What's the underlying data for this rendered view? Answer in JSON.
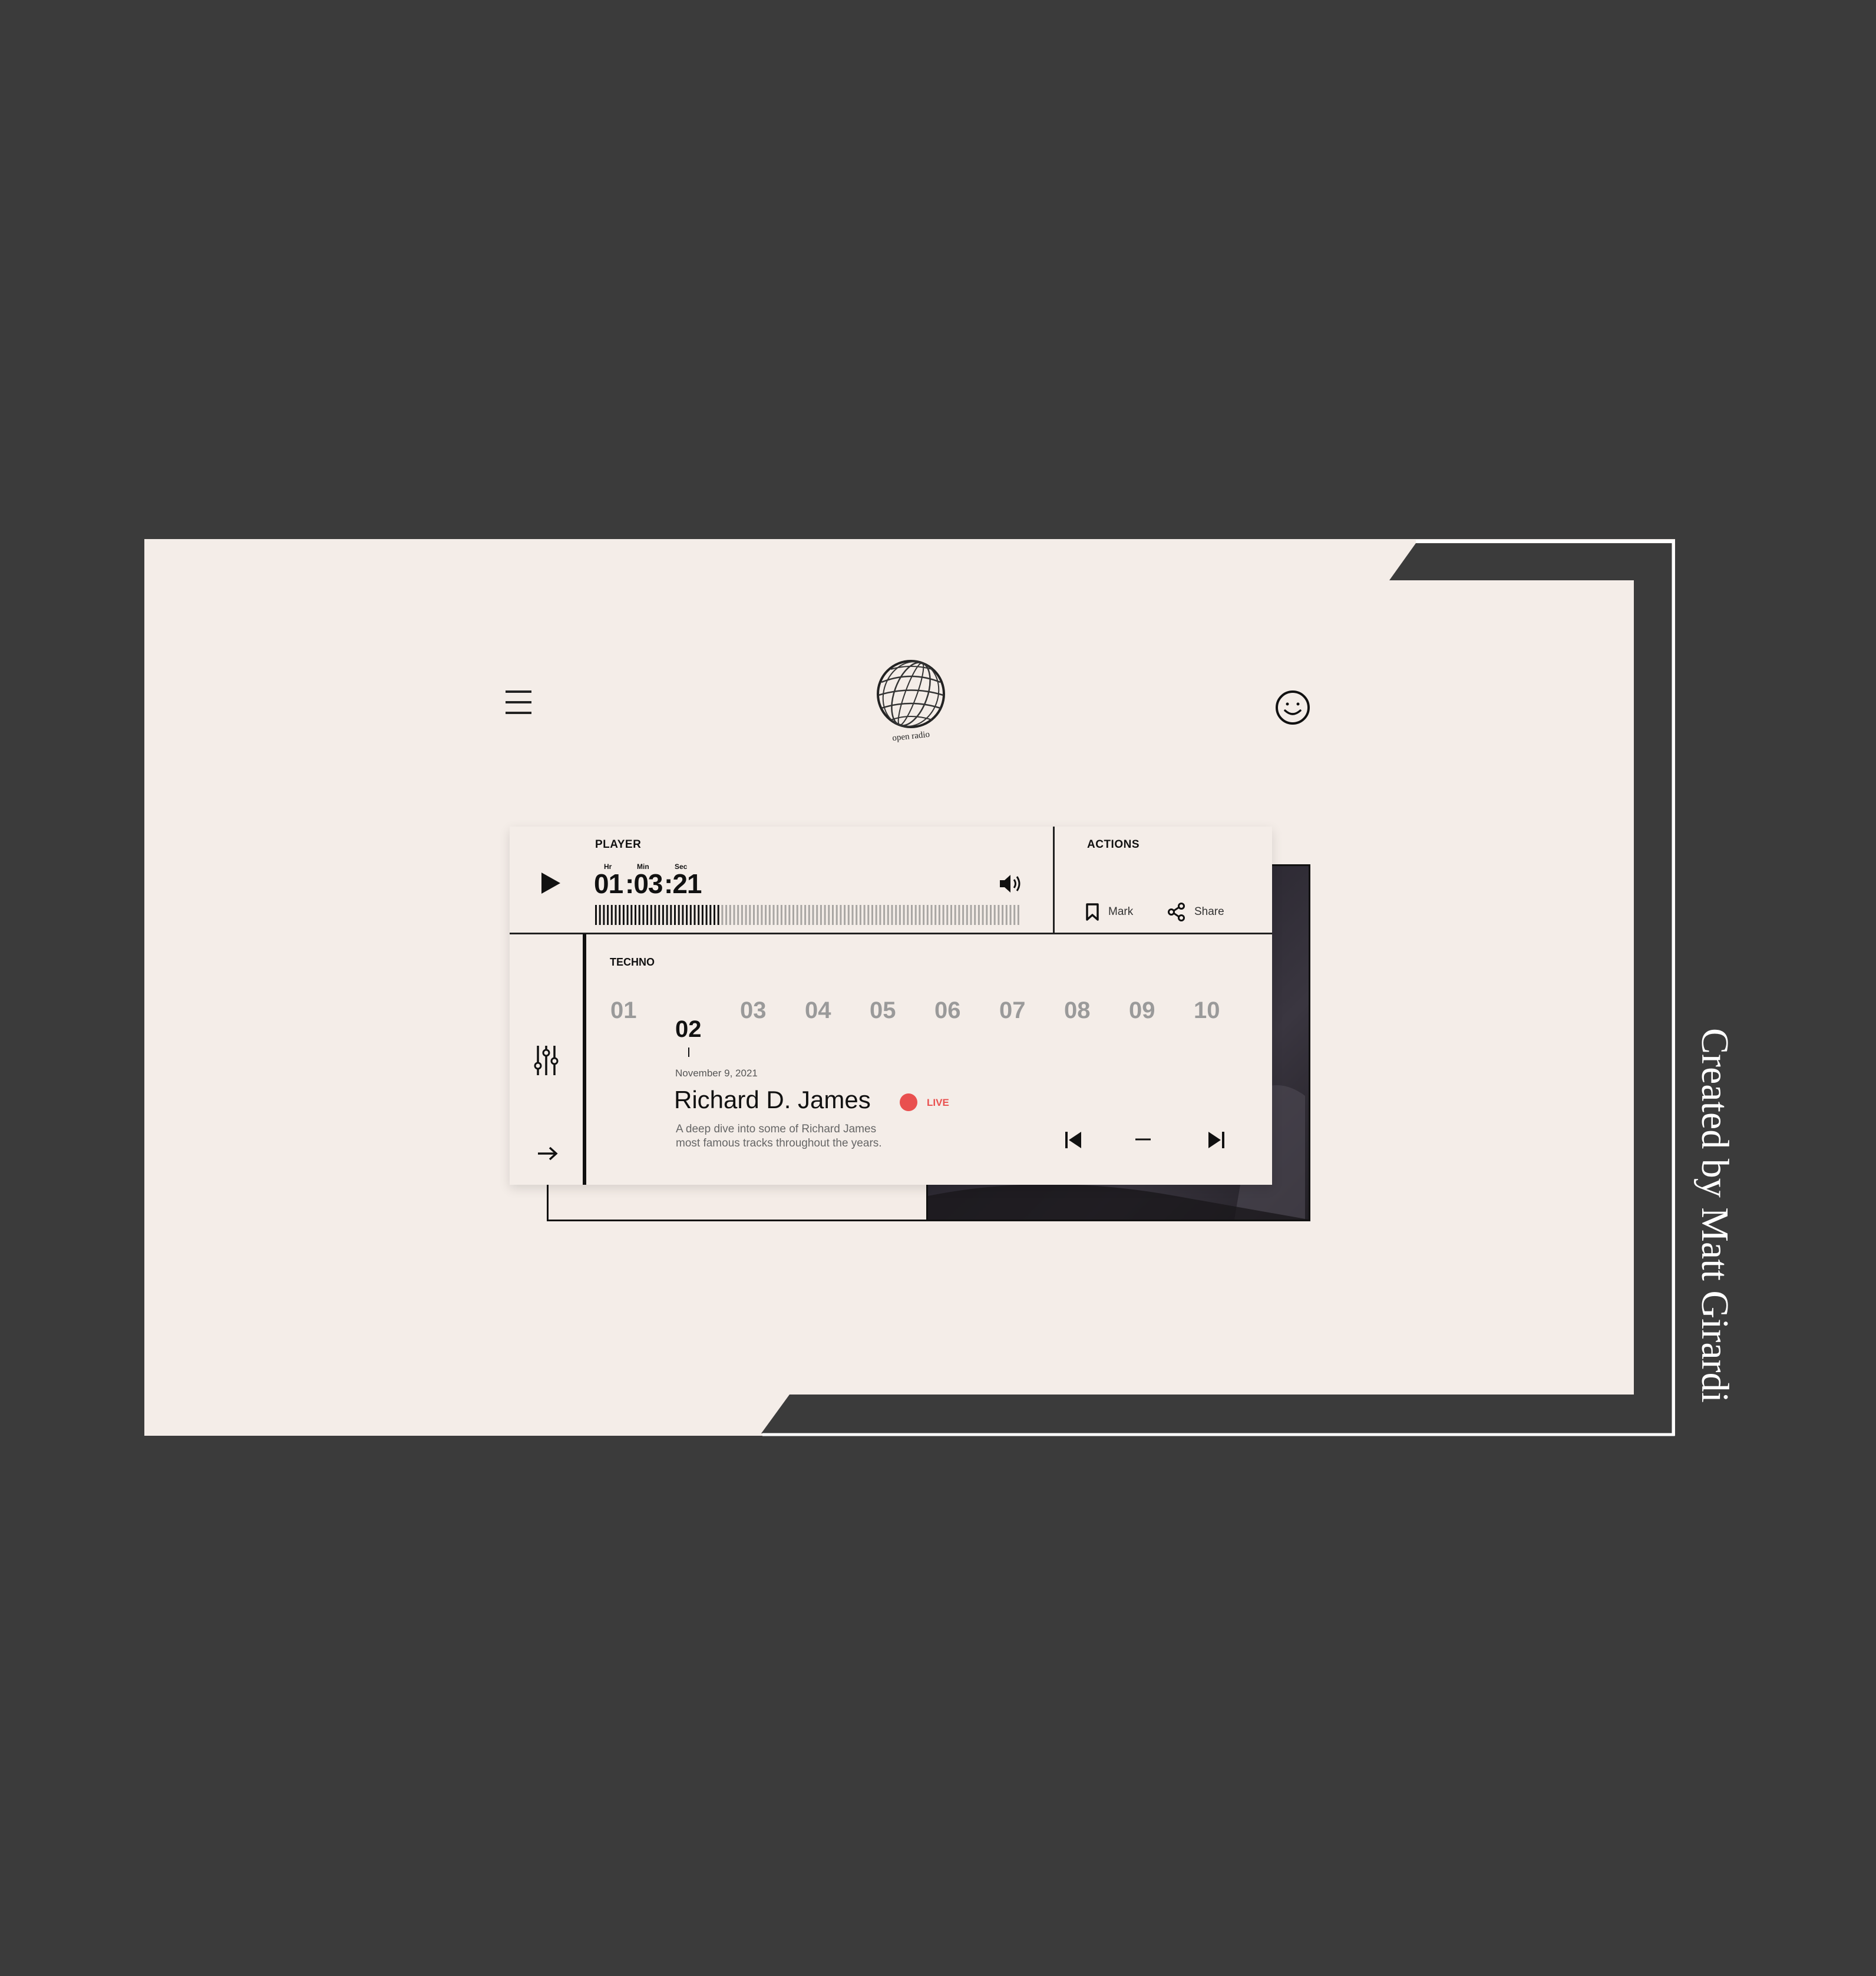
{
  "header": {
    "menu_icon": "hamburger-icon",
    "logo_text": "open radio",
    "account_icon": "smiley-icon"
  },
  "player": {
    "section_label": "PLAYER",
    "play_icon": "play-icon",
    "time": {
      "hr_label": "Hr",
      "min_label": "Min",
      "sec_label": "Sec",
      "hr": "01",
      "min": ":03",
      "sec": ":21"
    },
    "volume_icon": "volume-icon",
    "progress": 0.3
  },
  "actions": {
    "section_label": "ACTIONS",
    "mark_label": "Mark",
    "mark_icon": "bookmark-icon",
    "share_label": "Share",
    "share_icon": "share-icon"
  },
  "sidebar": {
    "equalizer_icon": "sliders-icon",
    "arrow_icon": "arrow-right-icon"
  },
  "tracklist": {
    "genre": "TECHNO",
    "tracks": [
      "01",
      "02",
      "03",
      "04",
      "05",
      "06",
      "07",
      "08",
      "09",
      "10"
    ],
    "active_index": 1,
    "date": "November 9, 2021",
    "artist": "Richard D. James",
    "live_label": "LIVE",
    "description_line1": "A deep dive into some of Richard James",
    "description_line2": "most famous tracks throughout the years."
  },
  "transport": {
    "prev_icon": "skip-back-icon",
    "stop_icon": "dash-icon",
    "next_icon": "skip-forward-icon"
  },
  "credit": "Created by Matt Girardi",
  "colors": {
    "background": "#3b3b3b",
    "canvas": "#f4ede8",
    "accent_live": "#e9504f",
    "ink": "#111111"
  }
}
